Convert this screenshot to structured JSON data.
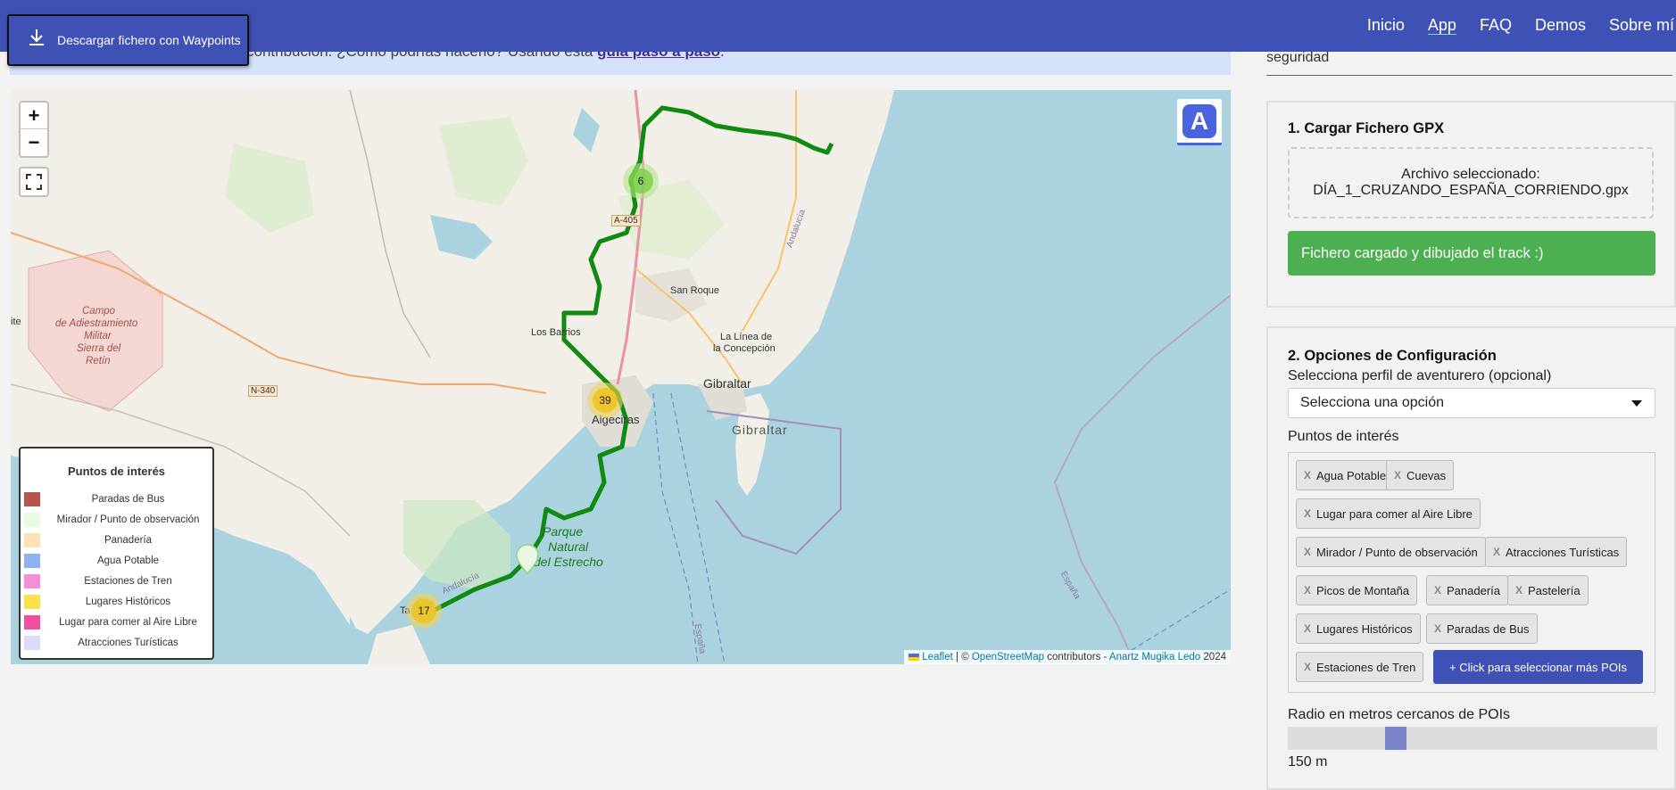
{
  "nav": {
    "links": [
      "Inicio",
      "App",
      "FAQ",
      "Demos",
      "Sobre mí"
    ],
    "active": "App"
  },
  "download_button": {
    "label": "Descargar fichero con Waypoints",
    "icon": "download-icon"
  },
  "notice": {
    "text": "contribución. ¿Cómo podrías hacerlo? Usando esta ",
    "link": "guía paso a paso",
    "end": "."
  },
  "map": {
    "zoom_in": "+",
    "zoom_out": "−",
    "fullscreen_icon": "fullscreen-icon",
    "logo_letter": "A",
    "clusters": [
      {
        "count": "6",
        "color": "green"
      },
      {
        "count": "39",
        "color": "yellow"
      },
      {
        "count": "17",
        "color": "yellow"
      }
    ],
    "labels": {
      "san_roque": "San Roque",
      "los_barrios": "Los Barrios",
      "la_linea": "La Línea de",
      "la_concepcion": "la Concepción",
      "gibraltar_city": "Gibraltar",
      "gibraltar_sea": "Gibraltar",
      "algeciras": "Algeciras",
      "parque1": "Parque",
      "parque2": "Natural",
      "parque3": "del Estrecho",
      "campo1": "Campo",
      "campo2": "de Adiestramiento",
      "campo3": "Militar",
      "campo4": "Sierra del",
      "campo5": "Retín",
      "a405": "A-405",
      "n340": "N-340",
      "andalucia1": "Andalucía",
      "andalucia2": "Andalucía",
      "espana1": "España",
      "espana2": "España",
      "ta": "Ta",
      "te": "ite"
    },
    "legend": {
      "title": "Puntos de interés",
      "items": [
        {
          "label": "Paradas de Bus",
          "color": "#b85450"
        },
        {
          "label": "Mirador / Punto de observación",
          "color": "#e8fbe0"
        },
        {
          "label": "Panadería",
          "color": "#fde2b5"
        },
        {
          "label": "Agua Potable",
          "color": "#8fb3f0"
        },
        {
          "label": "Estaciones de Tren",
          "color": "#f48ed6"
        },
        {
          "label": "Lugares Históricos",
          "color": "#fbe24a"
        },
        {
          "label": "Lugar para comer al Aire Libre",
          "color": "#f04fa0"
        },
        {
          "label": "Atracciones Turísticas",
          "color": "#dcdcf8"
        }
      ]
    },
    "attribution": {
      "leaflet": "Leaflet",
      "sep1": " | © ",
      "osm": "OpenStreetMap",
      "contrib": " contributors - ",
      "author": "Anartz Mugika Ledo",
      "year": " 2024"
    }
  },
  "panel": {
    "top_text": "seguridad",
    "card1": {
      "title": "1. Cargar Fichero GPX",
      "file_label": "Archivo seleccionado:",
      "file_name": "DÍA_1_CRUZANDO_ESPAÑA_CORRIENDO.gpx",
      "status": "Fichero cargado y dibujado el track :)"
    },
    "card2": {
      "title": "2. Opciones de Configuración",
      "profile_label": "Selecciona perfil de aventurero (opcional)",
      "profile_value": "Selecciona una opción",
      "poi_label": "Puntos de interés",
      "chips": [
        "Agua Potable",
        "Cuevas",
        "Lugar para comer al Aire Libre",
        "Mirador / Punto de observación",
        "Atracciones Turísticas",
        "Picos de Montaña",
        "Panadería",
        "Pastelería",
        "Lugares Históricos",
        "Paradas de Bus",
        "Estaciones de Tren"
      ],
      "chip_remove": "X",
      "more_button": "+ Click para seleccionar más POIs",
      "radius_label": "Radio en metros cercanos de POIs",
      "radius_value": "150 m",
      "radius_fraction": 0.28
    }
  },
  "colors": {
    "primary": "#3f51b5",
    "success": "#4caf50",
    "track": "#138a13",
    "sea": "#aad3df",
    "land": "#f2efe9"
  }
}
